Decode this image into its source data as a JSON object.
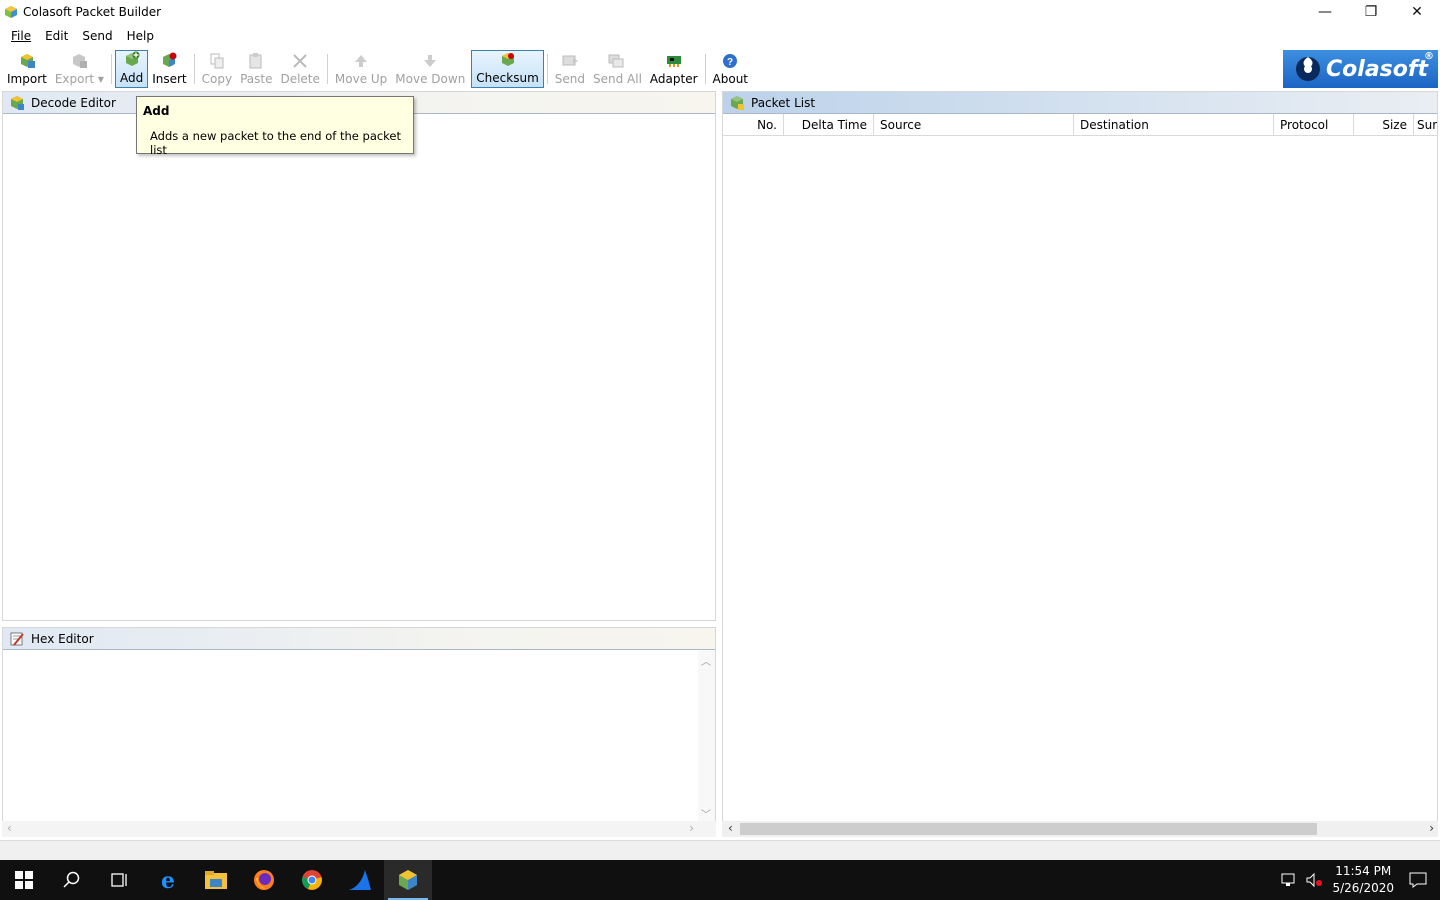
{
  "window": {
    "title": "Colasoft Packet Builder",
    "controls": {
      "minimize": "—",
      "restore": "❐",
      "close": "✕"
    }
  },
  "menu": [
    {
      "label": "File"
    },
    {
      "label": "Edit"
    },
    {
      "label": "Send"
    },
    {
      "label": "Help"
    }
  ],
  "toolbar": {
    "import": "Import",
    "export": "Export",
    "add": "Add",
    "insert": "Insert",
    "copy": "Copy",
    "paste": "Paste",
    "delete": "Delete",
    "move_up": "Move Up",
    "move_down": "Move Down",
    "checksum": "Checksum",
    "send": "Send",
    "send_all": "Send All",
    "adapter": "Adapter",
    "about": "About"
  },
  "logo": {
    "text": "Colasoft",
    "reg": "®"
  },
  "panels": {
    "decode_editor": "Decode Editor",
    "hex_editor": "Hex Editor",
    "packet_list": "Packet List"
  },
  "packet_list": {
    "columns": [
      "No.",
      "Delta Time",
      "Source",
      "Destination",
      "Protocol",
      "Size",
      "Sur"
    ]
  },
  "tooltip": {
    "title": "Add",
    "description": "Adds a new packet to the end of the packet list"
  },
  "taskbar": {
    "time": "11:54 PM",
    "date": "5/26/2020"
  },
  "colors": {
    "accent": "#3c7fb1",
    "logo_blue": "#1b64c4",
    "tooltip_bg": "#ffffe1",
    "taskbar_bg": "#101010"
  }
}
